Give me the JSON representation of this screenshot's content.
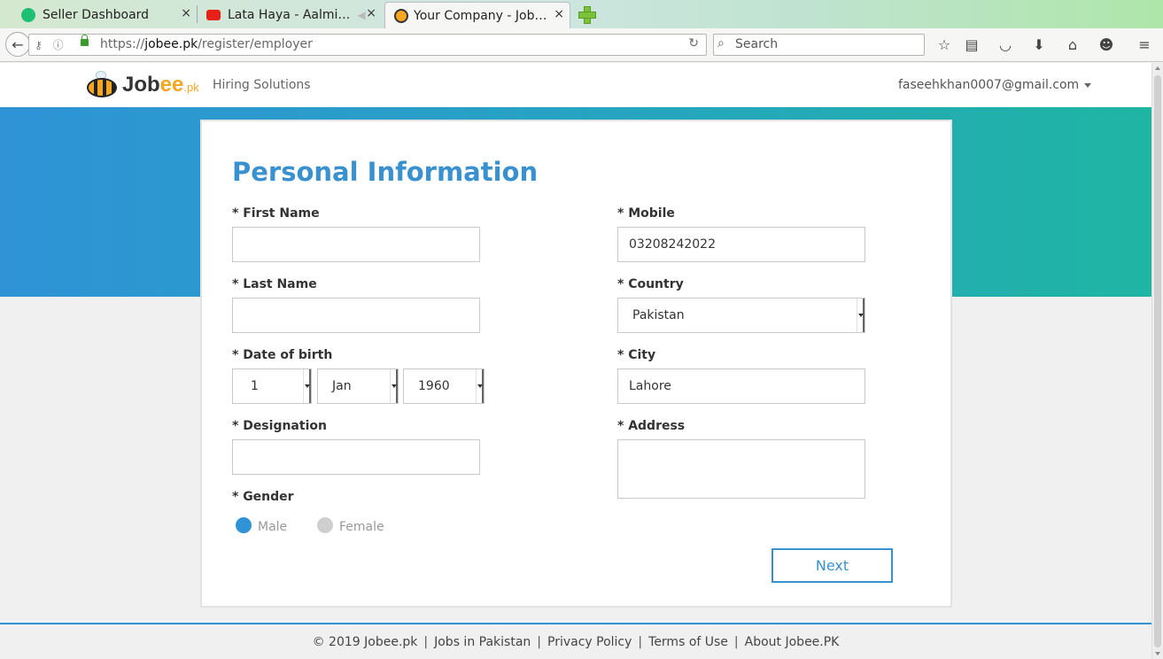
{
  "browser": {
    "tabs": [
      {
        "label": "Seller Dashboard",
        "close": "×",
        "favicon_color": "#1dbf73"
      },
      {
        "label": "Lata Haya - Aalmi…",
        "close": "×",
        "favicon_color": "#e62117"
      },
      {
        "label": "Your Company - Job…",
        "close": "×",
        "favicon_color": "#f5a623"
      }
    ],
    "url_prefix": "https://",
    "url_host": "jobee.pk",
    "url_path": "/register/employer",
    "search_placeholder": "Search"
  },
  "header": {
    "logo_main": "Job",
    "logo_ee": "ee",
    "logo_pk": ".pk",
    "hiring": "Hiring Solutions",
    "user_email": "faseehkhan0007@gmail.com"
  },
  "form": {
    "title": "Personal Information",
    "first_name_label": "* First Name",
    "first_name_value": "",
    "last_name_label": "* Last Name",
    "last_name_value": "",
    "dob_label": "* Date of birth",
    "dob_day": "1",
    "dob_month": "Jan",
    "dob_year": "1960",
    "designation_label": "* Designation",
    "designation_value": "",
    "gender_label": "* Gender",
    "gender_male": "Male",
    "gender_female": "Female",
    "gender_selected": "Male",
    "mobile_label": "* Mobile",
    "mobile_value": "03208242022",
    "country_label": "* Country",
    "country_value": "Pakistan",
    "city_label": "* City",
    "city_value": "Lahore",
    "address_label": "* Address",
    "address_value": "",
    "next_button": "Next"
  },
  "footer": {
    "copyright": "© 2019 Jobee.pk",
    "links": [
      "Jobs in Pakistan",
      "Privacy Policy",
      "Terms of Use",
      "About Jobee.PK"
    ],
    "separator": "|"
  },
  "colors": {
    "accent": "#3a91cf",
    "banner_start": "#2f93d6",
    "banner_end": "#1fb5a3"
  }
}
